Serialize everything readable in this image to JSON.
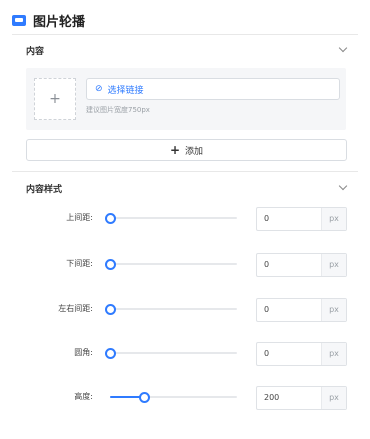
{
  "header": {
    "title": "图片轮播",
    "icon": "image-carousel-icon"
  },
  "content_section": {
    "title": "内容",
    "upload_plus": "+",
    "link_icon_glyph": "⊘",
    "link_label": "选择链接",
    "hint": "建议图片宽度750px",
    "add_plus": "+",
    "add_label": "添加"
  },
  "style_section": {
    "title": "内容样式",
    "rows": [
      {
        "label": "上间距:",
        "value": "0",
        "unit": "px",
        "level": 0
      },
      {
        "label": "下间距:",
        "value": "0",
        "unit": "px",
        "level": 0
      },
      {
        "label": "左右间距:",
        "value": "0",
        "unit": "px",
        "level": 0
      },
      {
        "label": "圆角:",
        "value": "0",
        "unit": "px",
        "level": 0
      },
      {
        "label": "高度:",
        "value": "200",
        "unit": "px",
        "level": 0.27
      }
    ]
  },
  "colors": {
    "accent": "#2f7bff",
    "panel_bg": "#f5f6f8",
    "border": "#d9dde2"
  }
}
